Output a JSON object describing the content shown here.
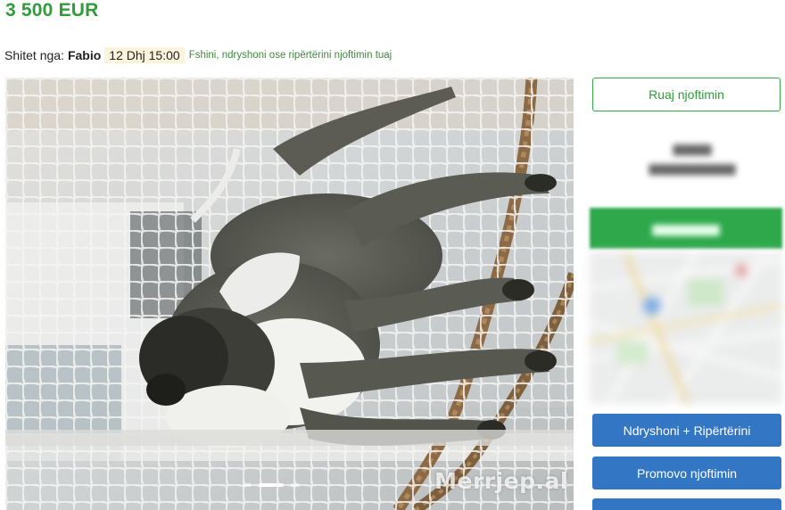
{
  "listing": {
    "price": "3 500 EUR",
    "sold_by_label": "Shitet nga:",
    "seller_name": "Fabio",
    "date": "12 Dhj 15:00",
    "manage_link": "Fshini, ndryshoni ose ripërtërini njoftimin tuaj"
  },
  "gallery": {
    "watermark": "Merrjep.al",
    "slide_count": 3,
    "active_slide": 2
  },
  "sidebar": {
    "save_label": "Ruaj njoftimin",
    "edit_label": "Ndryshoni + Ripërtërini",
    "promote_label": "Promovo njoftimin"
  },
  "colors": {
    "price_green": "#2e9d3a",
    "button_blue": "#3377c4",
    "phone_green": "#2ea84b",
    "date_badge": "#fbf3dc"
  }
}
